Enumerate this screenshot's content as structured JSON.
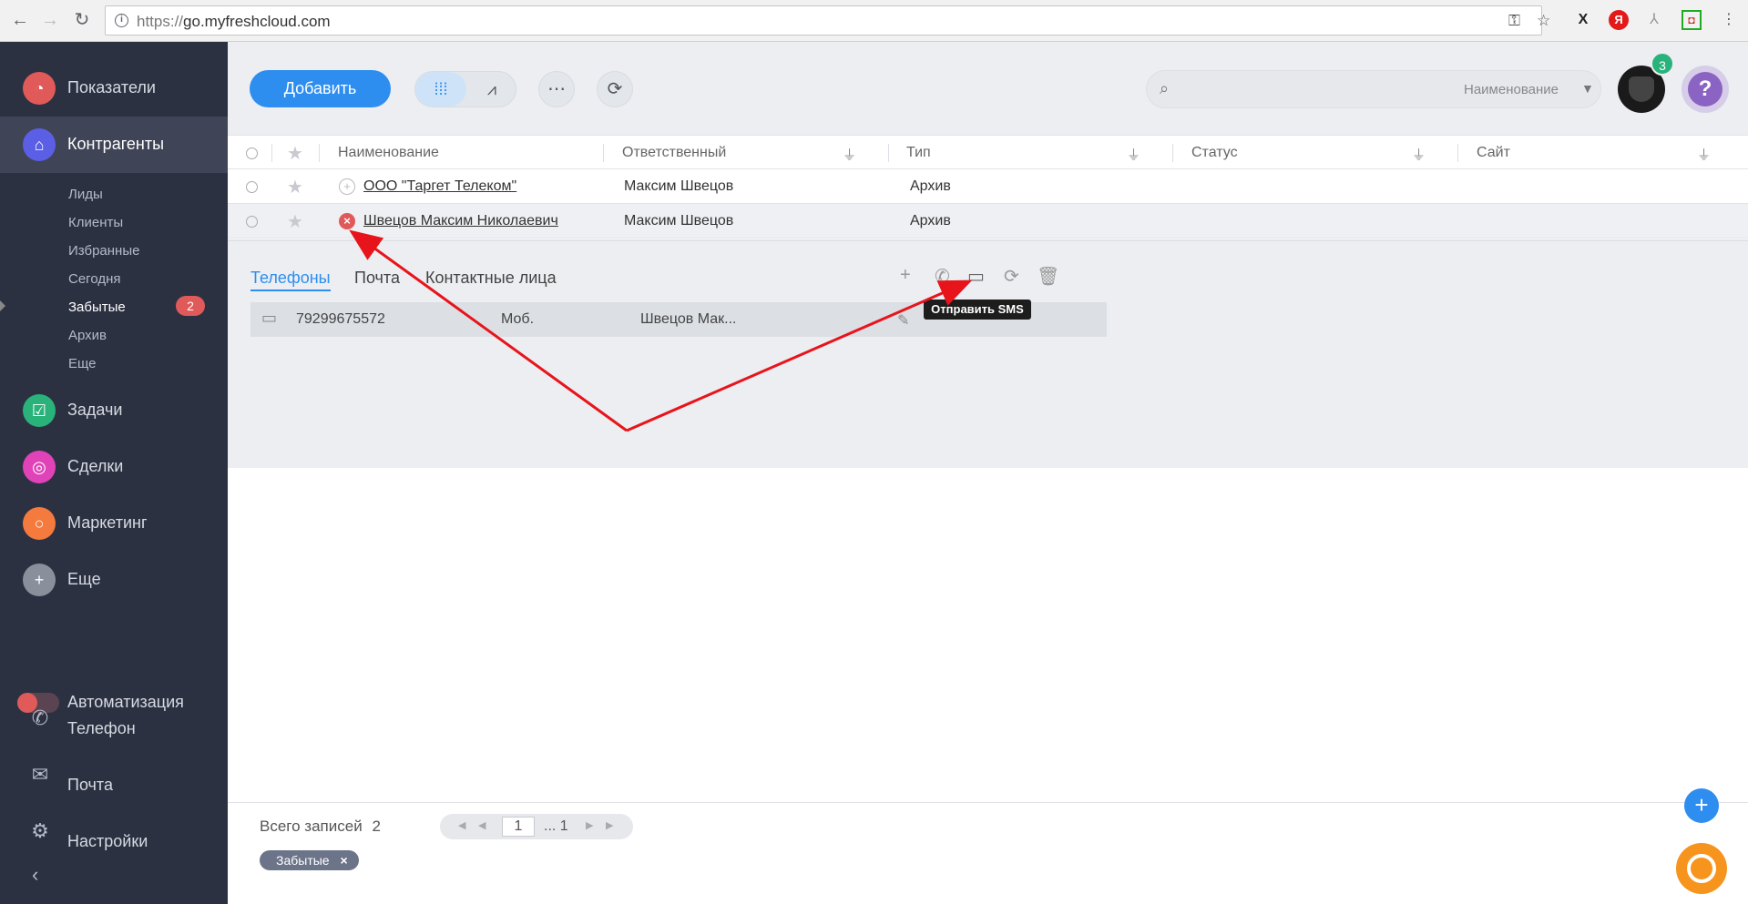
{
  "browser": {
    "url_scheme": "https://",
    "url_host": "go.myfreshcloud.com"
  },
  "sidebar": {
    "items": [
      {
        "label": "Показатели",
        "icon": "dashboard-icon",
        "color": "#e05a5a"
      },
      {
        "label": "Контрагенты",
        "icon": "home-icon",
        "color": "#5b5fe6"
      },
      {
        "label": "Задачи",
        "icon": "checkbox-icon",
        "color": "#2ab27b"
      },
      {
        "label": "Сделки",
        "icon": "target-icon",
        "color": "#e043b7"
      },
      {
        "label": "Маркетинг",
        "icon": "circle-icon",
        "color": "#f47a3d"
      },
      {
        "label": "Еще",
        "icon": "plus-icon",
        "color": "#8a8f9c"
      },
      {
        "label": "Автоматизация",
        "icon": "toggle-icon"
      },
      {
        "label": "Телефон",
        "icon": "phone-icon"
      },
      {
        "label": "Почта",
        "icon": "mail-icon"
      },
      {
        "label": "Настройки",
        "icon": "gear-icon"
      }
    ],
    "sub_items": [
      "Лиды",
      "Клиенты",
      "Избранные",
      "Сегодня",
      "Забытые",
      "Архив",
      "Еще"
    ],
    "forgotten_badge": "2"
  },
  "toolbar": {
    "add_label": "Добавить",
    "search_field": "Наименование",
    "avatar_badge": "3",
    "help_label": "?"
  },
  "table": {
    "columns": [
      "Наименование",
      "Ответственный",
      "Тип",
      "Статус",
      "Сайт"
    ],
    "rows": [
      {
        "name": "ООО \"Таргет Телеком\"",
        "responsible": "Максим Швецов",
        "type": "Архив",
        "status": "",
        "site": ""
      },
      {
        "name": "Швецов Максим Николаевич",
        "responsible": "Максим Швецов",
        "type": "Архив",
        "status": "",
        "site": ""
      }
    ]
  },
  "details": {
    "tabs": [
      "Телефоны",
      "Почта",
      "Контактные лица"
    ],
    "phone": {
      "number": "79299675572",
      "kind": "Моб.",
      "contact": "Швецов Мак..."
    },
    "tooltip": "Отправить SMS"
  },
  "footer": {
    "total_label": "Всего записей",
    "total_value": "2",
    "page_current": "1",
    "page_last": "... 1",
    "filter_chip": "Забытые"
  },
  "colors": {
    "accent": "#2d8ef0",
    "sidebar_bg": "#2c3142",
    "annotation_arrow": "#e8141b"
  }
}
